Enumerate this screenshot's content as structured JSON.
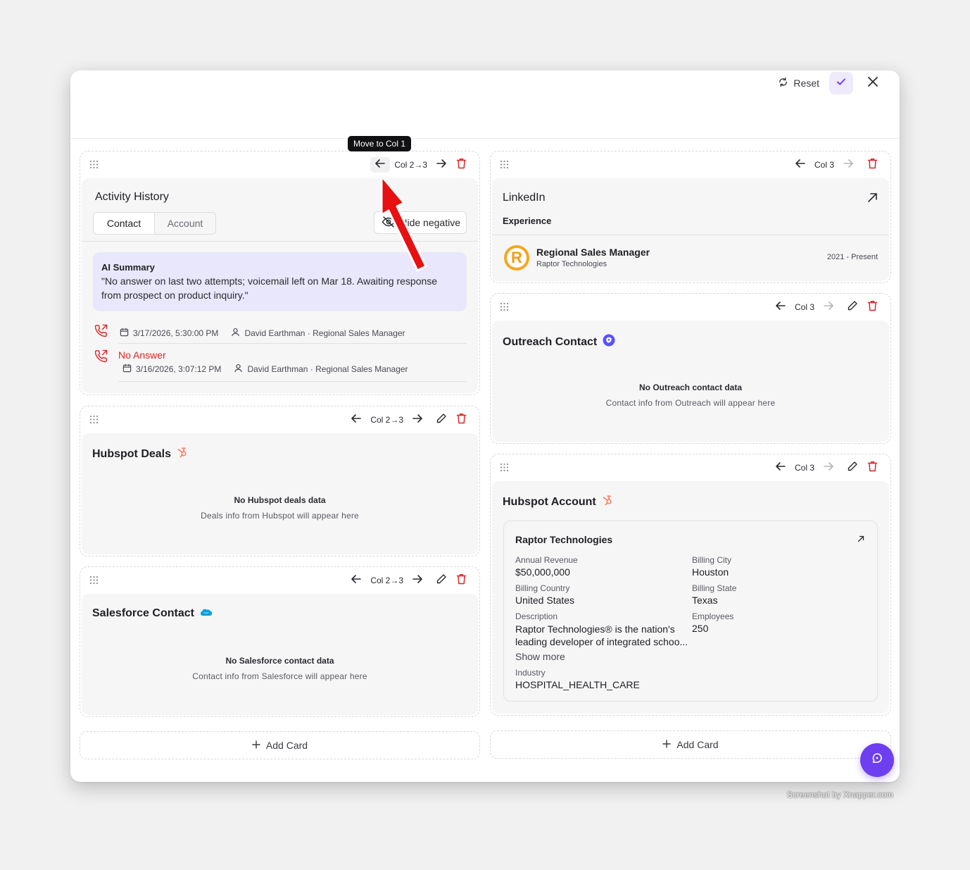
{
  "header": {
    "reset_label": "Reset"
  },
  "tooltip": "Move to Col 1",
  "activity": {
    "col_label": "Col 2→3",
    "title": "Activity History",
    "tabs": [
      "Contact",
      "Account"
    ],
    "hide_negative_label": "Hide negative",
    "ai_summary_title": "AI Summary",
    "ai_summary_text": "\"No answer on last two attempts; voicemail left on Mar 18. Awaiting response from prospect on product inquiry.\"",
    "items": [
      {
        "outcome": "",
        "datetime": "3/17/2026, 5:30:00 PM",
        "person": "David Earthman · Regional Sales Manager"
      },
      {
        "outcome": "No Answer",
        "datetime": "3/16/2026, 3:07:12 PM",
        "person": "David Earthman · Regional Sales Manager"
      }
    ]
  },
  "hubspot_deals": {
    "col_label": "Col 2→3",
    "title": "Hubspot Deals",
    "empty_title": "No Hubspot deals data",
    "empty_sub": "Deals info from Hubspot will appear here"
  },
  "salesforce_contact": {
    "col_label": "Col 2→3",
    "title": "Salesforce Contact",
    "empty_title": "No Salesforce contact data",
    "empty_sub": "Contact info from Salesforce will appear here"
  },
  "linkedin": {
    "col_label": "Col 3",
    "title": "LinkedIn",
    "section": "Experience",
    "logo_letter": "R",
    "job_title": "Regional Sales Manager",
    "company": "Raptor Technologies",
    "dates": "2021 - Present"
  },
  "outreach": {
    "col_label": "Col 3",
    "title": "Outreach Contact",
    "empty_title": "No Outreach contact data",
    "empty_sub": "Contact info from Outreach will appear here"
  },
  "hubspot_account": {
    "col_label": "Col 3",
    "title": "Hubspot Account",
    "company": "Raptor Technologies",
    "fields": {
      "annual_revenue_label": "Annual Revenue",
      "annual_revenue": "$50,000,000",
      "billing_city_label": "Billing City",
      "billing_city": "Houston",
      "billing_country_label": "Billing Country",
      "billing_country": "United States",
      "billing_state_label": "Billing State",
      "billing_state": "Texas",
      "description_label": "Description",
      "description_line1": "Raptor Technologies® is the nation's",
      "description_line2": "leading developer of integrated schoo...",
      "employees_label": "Employees",
      "employees": "250",
      "show_more": "Show more",
      "industry_label": "Industry",
      "industry": "HOSPITAL_HEALTH_CARE"
    }
  },
  "add_card_label": "Add Card",
  "watermark": "Screenshot by Xnapper.com",
  "colors": {
    "accent": "#6e3ff0",
    "danger": "#e02424",
    "hubspot": "#ff7a59",
    "salesforce": "#00a1e0",
    "outreach": "#5951ff",
    "ai_bg": "#e9e7fb"
  }
}
